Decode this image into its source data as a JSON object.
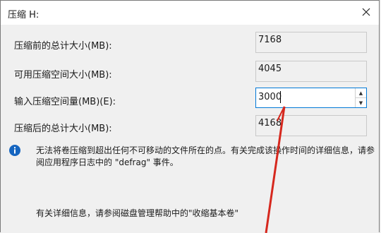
{
  "dialog": {
    "title": "压缩 H:",
    "close_icon": "close-icon"
  },
  "rows": [
    {
      "label": "压缩前的总计大小(MB):",
      "value": "7168"
    },
    {
      "label": "可用压缩空间大小(MB):",
      "value": "4045"
    },
    {
      "label": "输入压缩空间量(MB)(E):",
      "value": "3000"
    },
    {
      "label": "压缩后的总计大小(MB):",
      "value": "4168"
    }
  ],
  "info": {
    "icon": "info-icon",
    "text": "无法将卷压缩到超出任何不可移动的文件所在的点。有关完成该操作时间的详细信息，请参阅应用程序日志中的 \"defrag\" 事件。"
  },
  "help": {
    "text": "有关详细信息，请参阅磁盘管理帮助中的\"收缩基本卷\""
  },
  "annotation": {
    "arrow_color": "#d6281e"
  }
}
